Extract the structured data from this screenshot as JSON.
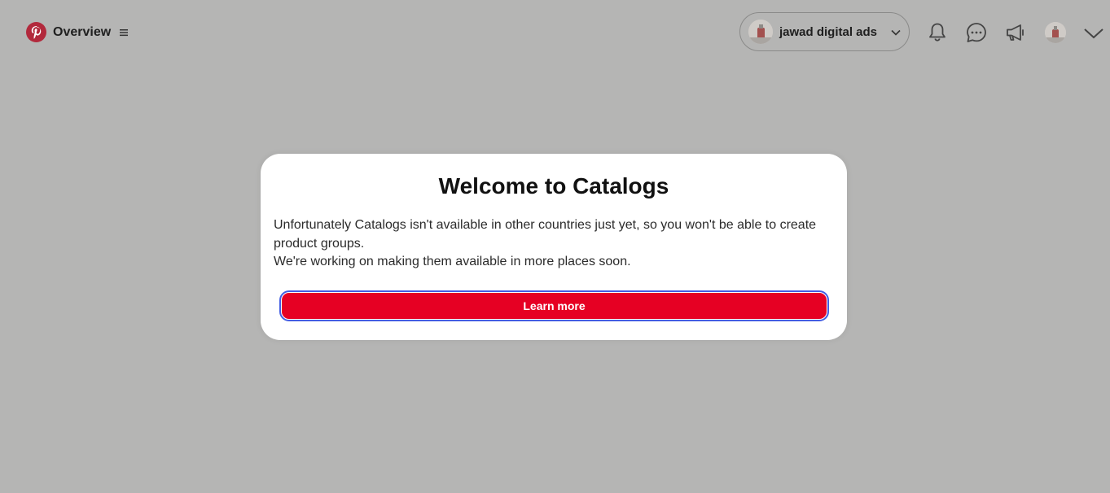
{
  "nav": {
    "brand_icon": "pinterest-logo",
    "title": "Overview",
    "menu_icon": "hamburger-icon"
  },
  "account": {
    "name": "jawad digital ads",
    "avatar_icon": "account-avatar",
    "chevron_icon": "chevron-down-icon"
  },
  "header_icons": [
    "bell-icon",
    "chat-bubble-icon",
    "megaphone-icon",
    "profile-avatar",
    "chevron-down-icon"
  ],
  "modal": {
    "title": "Welcome to Catalogs",
    "line1": "Unfortunately Catalogs isn't available in other countries just yet, so you won't be able to create product groups.",
    "line2": "We're working on making them available in more places soon.",
    "button_label": "Learn more"
  },
  "colors": {
    "brand_red": "#e60023",
    "overlay_bg": "#b5b5b4",
    "focus_ring": "#435ee3",
    "modal_bg": "#ffffff"
  }
}
